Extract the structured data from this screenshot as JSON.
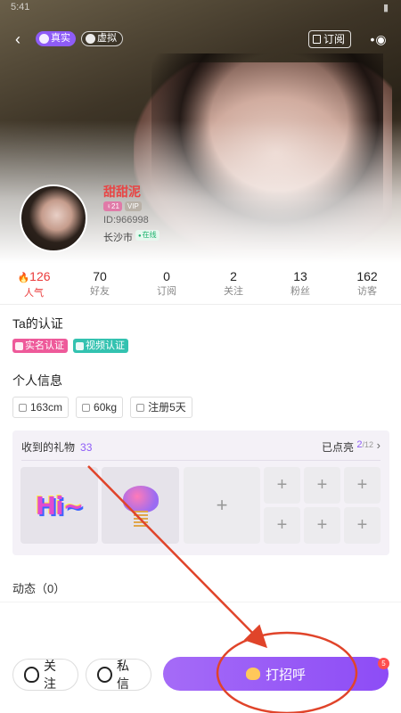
{
  "status": {
    "time": "5:41"
  },
  "topbar": {
    "back_icon": "arrow-left-icon",
    "seg_real": "真实",
    "seg_virtual": "虚拟",
    "subscribe": "订阅",
    "more_icon": "more-dots-icon"
  },
  "profile": {
    "username": "甜甜泥",
    "age": "21",
    "level": "VIP",
    "id": "ID:966998",
    "city": "长沙市",
    "online": "在线"
  },
  "stats": [
    {
      "num": "126",
      "label": "人气"
    },
    {
      "num": "70",
      "label": "好友"
    },
    {
      "num": "0",
      "label": "订阅"
    },
    {
      "num": "2",
      "label": "关注"
    },
    {
      "num": "13",
      "label": "粉丝"
    },
    {
      "num": "162",
      "label": "访客"
    }
  ],
  "cert": {
    "title": "Ta的认证",
    "name_tag": "实名认证",
    "video_tag": "视频认证"
  },
  "info": {
    "title": "个人信息",
    "height": "163cm",
    "weight": "60kg",
    "registered": "注册5天"
  },
  "gifts": {
    "title": "收到的礼物",
    "count": "33",
    "lit_label": "已点亮",
    "lit_num": "2",
    "lit_total": "/12",
    "gift1": "Hi~",
    "plus": "+"
  },
  "dynamics": {
    "label": "动态（0）"
  },
  "bottom": {
    "follow": "关注",
    "message": "私信",
    "greet": "打招呼",
    "greet_badge": "5"
  },
  "colors": {
    "accent": "#8e5cf7",
    "hot": "#ea3a3a",
    "annotation": "#e0442a"
  }
}
